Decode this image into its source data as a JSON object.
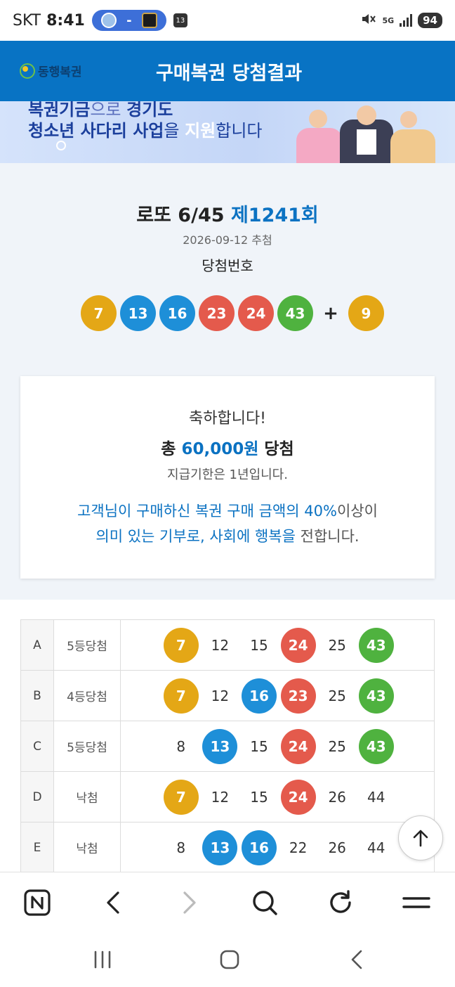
{
  "status_bar": {
    "carrier": "SKT",
    "time": "8:41",
    "score_separator": "-",
    "calendar_badge": "13",
    "network": "5G",
    "battery": "94"
  },
  "header": {
    "logo_text": "동행복권",
    "title": "구매복권 당첨결과"
  },
  "banner": {
    "line1_a": "복권기금",
    "line1_b": "으로 ",
    "line1_c": "경기도",
    "line2_a": "청소년 사다리 사업",
    "line2_b": "을 ",
    "line2_c": "지원",
    "line2_d": "합니다"
  },
  "result": {
    "game_name": "로또 6/45",
    "round": "제1241회",
    "draw_date": "2026-09-12 추첨",
    "win_numbers_label": "당첨번호",
    "winning_numbers": [
      "7",
      "13",
      "16",
      "23",
      "24",
      "43"
    ],
    "bonus_plus": "+",
    "bonus_number": "9"
  },
  "congrats": {
    "hello": "축하합니다!",
    "total_prefix": "총 ",
    "total_amount": "60,000원",
    "total_suffix": " 당첨",
    "payment_limit": "지급기한은 1년입니다.",
    "msg_line1_a": "고객님이 구매하신 복권 구매 금액의 40%",
    "msg_line1_b": "이상이",
    "msg_line2_a": "의미 있는 기부로, 사회에 행복을",
    "msg_line2_b": " 전합니다."
  },
  "games": [
    {
      "id": "A",
      "rank": "5등당첨",
      "numbers": [
        {
          "n": "7",
          "c": "yellow"
        },
        {
          "n": "12",
          "c": ""
        },
        {
          "n": "15",
          "c": ""
        },
        {
          "n": "24",
          "c": "red"
        },
        {
          "n": "25",
          "c": ""
        },
        {
          "n": "43",
          "c": "green"
        }
      ]
    },
    {
      "id": "B",
      "rank": "4등당첨",
      "numbers": [
        {
          "n": "7",
          "c": "yellow"
        },
        {
          "n": "12",
          "c": ""
        },
        {
          "n": "16",
          "c": "blue"
        },
        {
          "n": "23",
          "c": "red"
        },
        {
          "n": "25",
          "c": ""
        },
        {
          "n": "43",
          "c": "green"
        }
      ]
    },
    {
      "id": "C",
      "rank": "5등당첨",
      "numbers": [
        {
          "n": "8",
          "c": ""
        },
        {
          "n": "13",
          "c": "blue"
        },
        {
          "n": "15",
          "c": ""
        },
        {
          "n": "24",
          "c": "red"
        },
        {
          "n": "25",
          "c": ""
        },
        {
          "n": "43",
          "c": "green"
        }
      ]
    },
    {
      "id": "D",
      "rank": "낙첨",
      "numbers": [
        {
          "n": "7",
          "c": "yellow"
        },
        {
          "n": "12",
          "c": ""
        },
        {
          "n": "15",
          "c": ""
        },
        {
          "n": "24",
          "c": "red"
        },
        {
          "n": "26",
          "c": ""
        },
        {
          "n": "44",
          "c": ""
        }
      ]
    },
    {
      "id": "E",
      "rank": "낙첨",
      "numbers": [
        {
          "n": "8",
          "c": ""
        },
        {
          "n": "13",
          "c": "blue"
        },
        {
          "n": "16",
          "c": "blue"
        },
        {
          "n": "22",
          "c": ""
        },
        {
          "n": "26",
          "c": ""
        },
        {
          "n": "44",
          "c": ""
        }
      ]
    }
  ],
  "ball_colors": {
    "yellow": "#e4a716",
    "blue": "#1e8fd8",
    "red": "#e45a4c",
    "green": "#4fb23f"
  },
  "toolbar": {
    "icons": [
      "naver-home-icon",
      "back-icon",
      "forward-icon",
      "search-icon",
      "refresh-icon",
      "menu-icon"
    ]
  },
  "navbar": {
    "icons": [
      "recent-apps-icon",
      "home-icon",
      "back-nav-icon"
    ]
  }
}
